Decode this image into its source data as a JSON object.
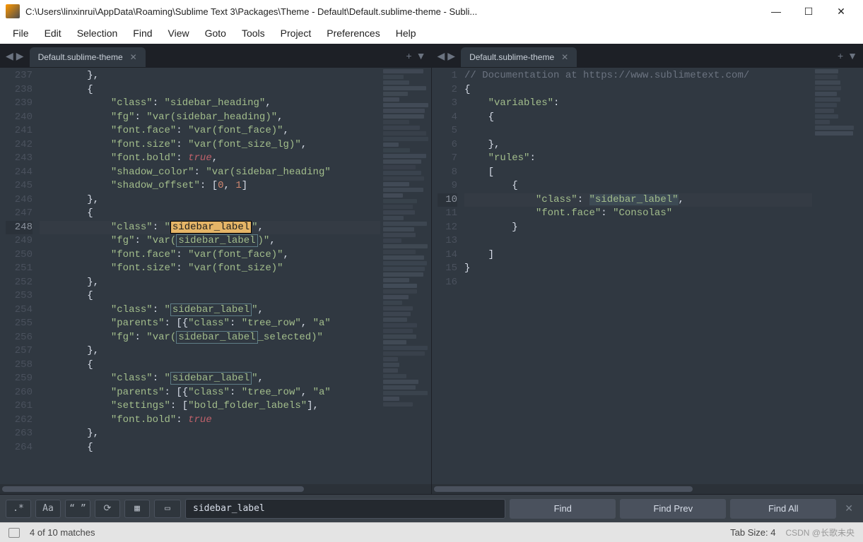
{
  "window": {
    "title": "C:\\Users\\linxinrui\\AppData\\Roaming\\Sublime Text 3\\Packages\\Theme - Default\\Default.sublime-theme - Subli..."
  },
  "menu": [
    "File",
    "Edit",
    "Selection",
    "Find",
    "View",
    "Goto",
    "Tools",
    "Project",
    "Preferences",
    "Help"
  ],
  "panes": {
    "left": {
      "tab": "Default.sublime-theme"
    },
    "right": {
      "tab": "Default.sublime-theme"
    }
  },
  "left_gutter_start": 237,
  "left_lines": [
    {
      "n": 237,
      "t": "        },"
    },
    {
      "n": 238,
      "t": "        {"
    },
    {
      "n": 239,
      "t": "            \"class\": \"sidebar_heading\","
    },
    {
      "n": 240,
      "t": "            \"fg\": \"var(sidebar_heading)\","
    },
    {
      "n": 241,
      "t": "            \"font.face\": \"var(font_face)\","
    },
    {
      "n": 242,
      "t": "            \"font.size\": \"var(font_size_lg)\","
    },
    {
      "n": 243,
      "t": "            \"font.bold\": true,"
    },
    {
      "n": 244,
      "t": "            \"shadow_color\": \"var(sidebar_heading"
    },
    {
      "n": 245,
      "t": "            \"shadow_offset\": [0, 1]"
    },
    {
      "n": 246,
      "t": "        },"
    },
    {
      "n": 247,
      "t": "        {"
    },
    {
      "n": 248,
      "t": "            \"class\": \"sidebar_label\",",
      "active": true,
      "hl": "box"
    },
    {
      "n": 249,
      "t": "            \"fg\": \"var(sidebar_label)\",",
      "hl": "outline"
    },
    {
      "n": 250,
      "t": "            \"font.face\": \"var(font_face)\","
    },
    {
      "n": 251,
      "t": "            \"font.size\": \"var(font_size)\""
    },
    {
      "n": 252,
      "t": "        },"
    },
    {
      "n": 253,
      "t": "        {"
    },
    {
      "n": 254,
      "t": "            \"class\": \"sidebar_label\",",
      "hl": "outline"
    },
    {
      "n": 255,
      "t": "            \"parents\": [{\"class\": \"tree_row\", \"a"
    },
    {
      "n": 256,
      "t": "            \"fg\": \"var(sidebar_label_selected)\"",
      "hl": "outline"
    },
    {
      "n": 257,
      "t": "        },"
    },
    {
      "n": 258,
      "t": "        {"
    },
    {
      "n": 259,
      "t": "            \"class\": \"sidebar_label\",",
      "hl": "outline"
    },
    {
      "n": 260,
      "t": "            \"parents\": [{\"class\": \"tree_row\", \"a"
    },
    {
      "n": 261,
      "t": "            \"settings\": [\"bold_folder_labels\"],"
    },
    {
      "n": 262,
      "t": "            \"font.bold\": true"
    },
    {
      "n": 263,
      "t": "        },"
    },
    {
      "n": 264,
      "t": "        {"
    }
  ],
  "right_lines": [
    {
      "n": 1,
      "t": "// Documentation at https://www.sublimetext.com/"
    },
    {
      "n": 2,
      "t": "{"
    },
    {
      "n": 3,
      "t": "    \"variables\":"
    },
    {
      "n": 4,
      "t": "    {"
    },
    {
      "n": 5,
      "t": ""
    },
    {
      "n": 6,
      "t": "    },"
    },
    {
      "n": 7,
      "t": "    \"rules\":"
    },
    {
      "n": 8,
      "t": "    ["
    },
    {
      "n": 9,
      "t": "        {"
    },
    {
      "n": 10,
      "t": "            \"class\": \"sidebar_label\",",
      "active": true,
      "hl": "str"
    },
    {
      "n": 11,
      "t": "            \"font.face\": \"Consolas\""
    },
    {
      "n": 12,
      "t": "        }"
    },
    {
      "n": 13,
      "t": ""
    },
    {
      "n": 14,
      "t": "    ]"
    },
    {
      "n": 15,
      "t": "}"
    },
    {
      "n": 16,
      "t": ""
    }
  ],
  "find": {
    "mode_regex": ".*",
    "mode_case": "Aa",
    "mode_word": "“ ”",
    "mode_wrap": "⟳",
    "mode_sel": "▦",
    "mode_hl": "▭",
    "input": "sidebar_label",
    "btn_find": "Find",
    "btn_prev": "Find Prev",
    "btn_all": "Find All"
  },
  "status": {
    "matches": "4 of 10 matches",
    "tab_size": "Tab Size: 4",
    "watermark": "CSDN @长歌未央"
  }
}
